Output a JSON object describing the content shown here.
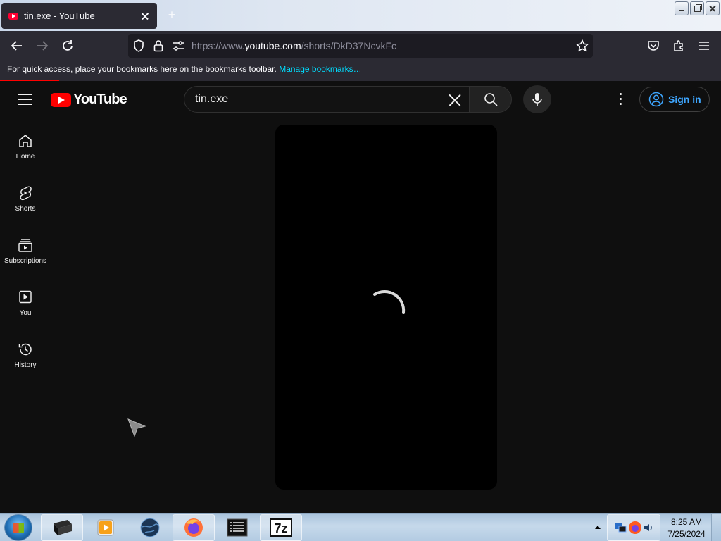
{
  "browser": {
    "tab_title": "tin.exe - YouTube",
    "new_tab": "+",
    "url_prefix": "https://www.",
    "url_host": "youtube.com",
    "url_path": "/shorts/DkD37NcvkFc",
    "bookmarks_hint": "For quick access, place your bookmarks here on the bookmarks toolbar.",
    "manage_bookmarks": "Manage bookmarks…",
    "icons": [
      "back-icon",
      "forward-icon",
      "reload-icon",
      "shield-icon",
      "lock-icon",
      "permissions-icon",
      "star-icon",
      "pocket-icon",
      "extensions-icon",
      "menu-icon"
    ]
  },
  "youtube": {
    "logo_text": "YouTube",
    "search_value": "tin.exe",
    "sign_in": "Sign in",
    "sidebar": [
      {
        "label": "Home",
        "icon": "home-icon"
      },
      {
        "label": "Shorts",
        "icon": "shorts-icon"
      },
      {
        "label": "Subscriptions",
        "icon": "subscriptions-icon"
      },
      {
        "label": "You",
        "icon": "you-icon"
      },
      {
        "label": "History",
        "icon": "history-icon"
      }
    ],
    "player_state": "loading",
    "colors": {
      "accent": "#ff0000",
      "link": "#3ea6ff",
      "background": "#0f0f0f"
    }
  },
  "taskbar": {
    "time": "8:25 AM",
    "date": "7/25/2024",
    "apps": [
      "terminal-app",
      "media-player-app",
      "globe-app",
      "firefox-app",
      "notepad-app",
      "7zip-app"
    ],
    "sevenzip_label": "7z"
  }
}
